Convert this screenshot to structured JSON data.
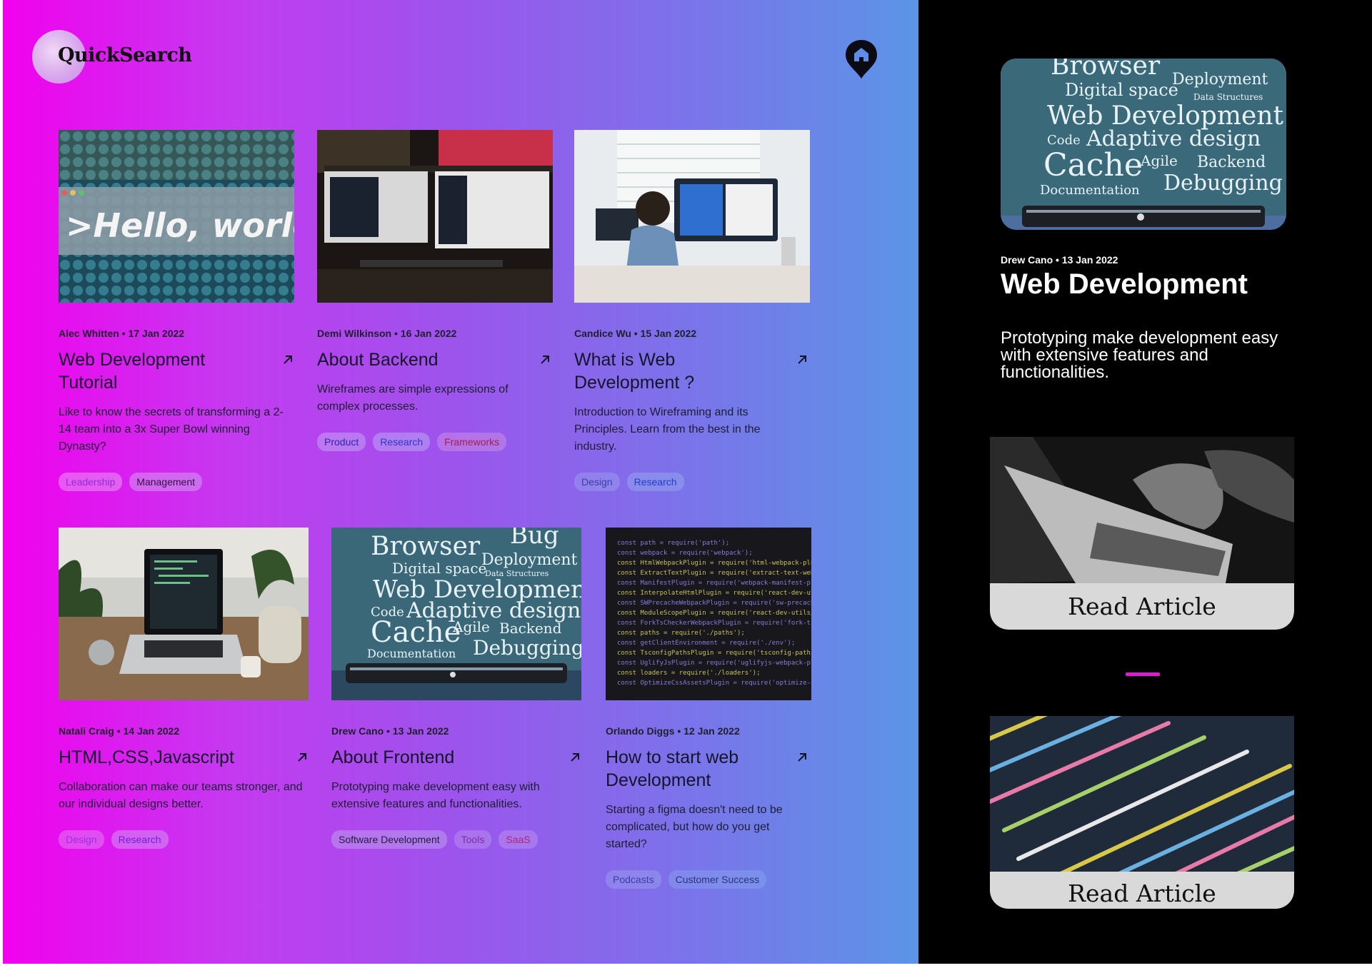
{
  "app": {
    "logo": "QuickSearch"
  },
  "colors": {
    "gradient_start": "#f200ee",
    "gradient_end": "#5b95e6",
    "side_bg": "#000000",
    "divider": "#e01ad2"
  },
  "cards": [
    {
      "meta": "Alec Whitten • 17 Jan 2022",
      "title": "Web Development Tutorial",
      "desc": "Like to know the secrets of transforming a 2-14 team into a 3x Super Bowl winning Dynasty?",
      "image": "hello-world-keyboard",
      "tags": [
        "Leadership",
        "Management"
      ]
    },
    {
      "meta": "Demi Wilkinson • 16 Jan 2022",
      "title": "About Backend",
      "desc": "Wireframes  are simple expressions of complex processes.",
      "image": "dual-monitor-desk",
      "tags": [
        "Product",
        "Research",
        "Frameworks"
      ]
    },
    {
      "meta": "Candice Wu • 15 Jan 2022",
      "title": "What is Web Development ?",
      "desc": "Introduction to Wireframing and its Principles. Learn from the best in the industry.",
      "image": "man-at-monitors",
      "tags": [
        "Design",
        "Research"
      ]
    },
    {
      "meta": "Natali Craig • 14 Jan 2022",
      "title": "HTML,CSS,Javascript",
      "desc": "Collaboration can make our teams stronger, and our individual designs better.",
      "image": "laptop-on-table",
      "tags": [
        "Design",
        "Research"
      ]
    },
    {
      "meta": "Drew Cano • 13 Jan 2022",
      "title": "About Frontend",
      "desc": "Prototyping  make development easy with extensive features and functionalities.",
      "image": "word-cloud-monitor",
      "tags": [
        "Software Development",
        "Tools",
        "SaaS"
      ]
    },
    {
      "meta": "Orlando Diggs • 12 Jan 2022",
      "title": "How to start web Development",
      "desc": "Starting a figma doesn't need to be complicated, but how do you get started?",
      "image": "code-screen",
      "tags": [
        "Podcasts",
        "Customer Success"
      ]
    }
  ],
  "featured": {
    "meta": "Drew Cano • 13 Jan 2022",
    "title": "Web Development",
    "desc": "Prototyping  make development easy with extensive features and functionalities.",
    "image": "word-cloud-monitor"
  },
  "read_cards": [
    {
      "label": "Read Article",
      "image": "hands-on-laptop-bw"
    },
    {
      "label": "Read Article",
      "image": "colorful-code-closeup"
    }
  ],
  "word_cloud": [
    "Bug",
    "Browser",
    "Deployment",
    "Digital space",
    "Data Structures",
    "Web Development",
    "Code",
    "Adaptive design",
    "Cache",
    "Agile",
    "Backend",
    "Documentation",
    "Debugging"
  ]
}
